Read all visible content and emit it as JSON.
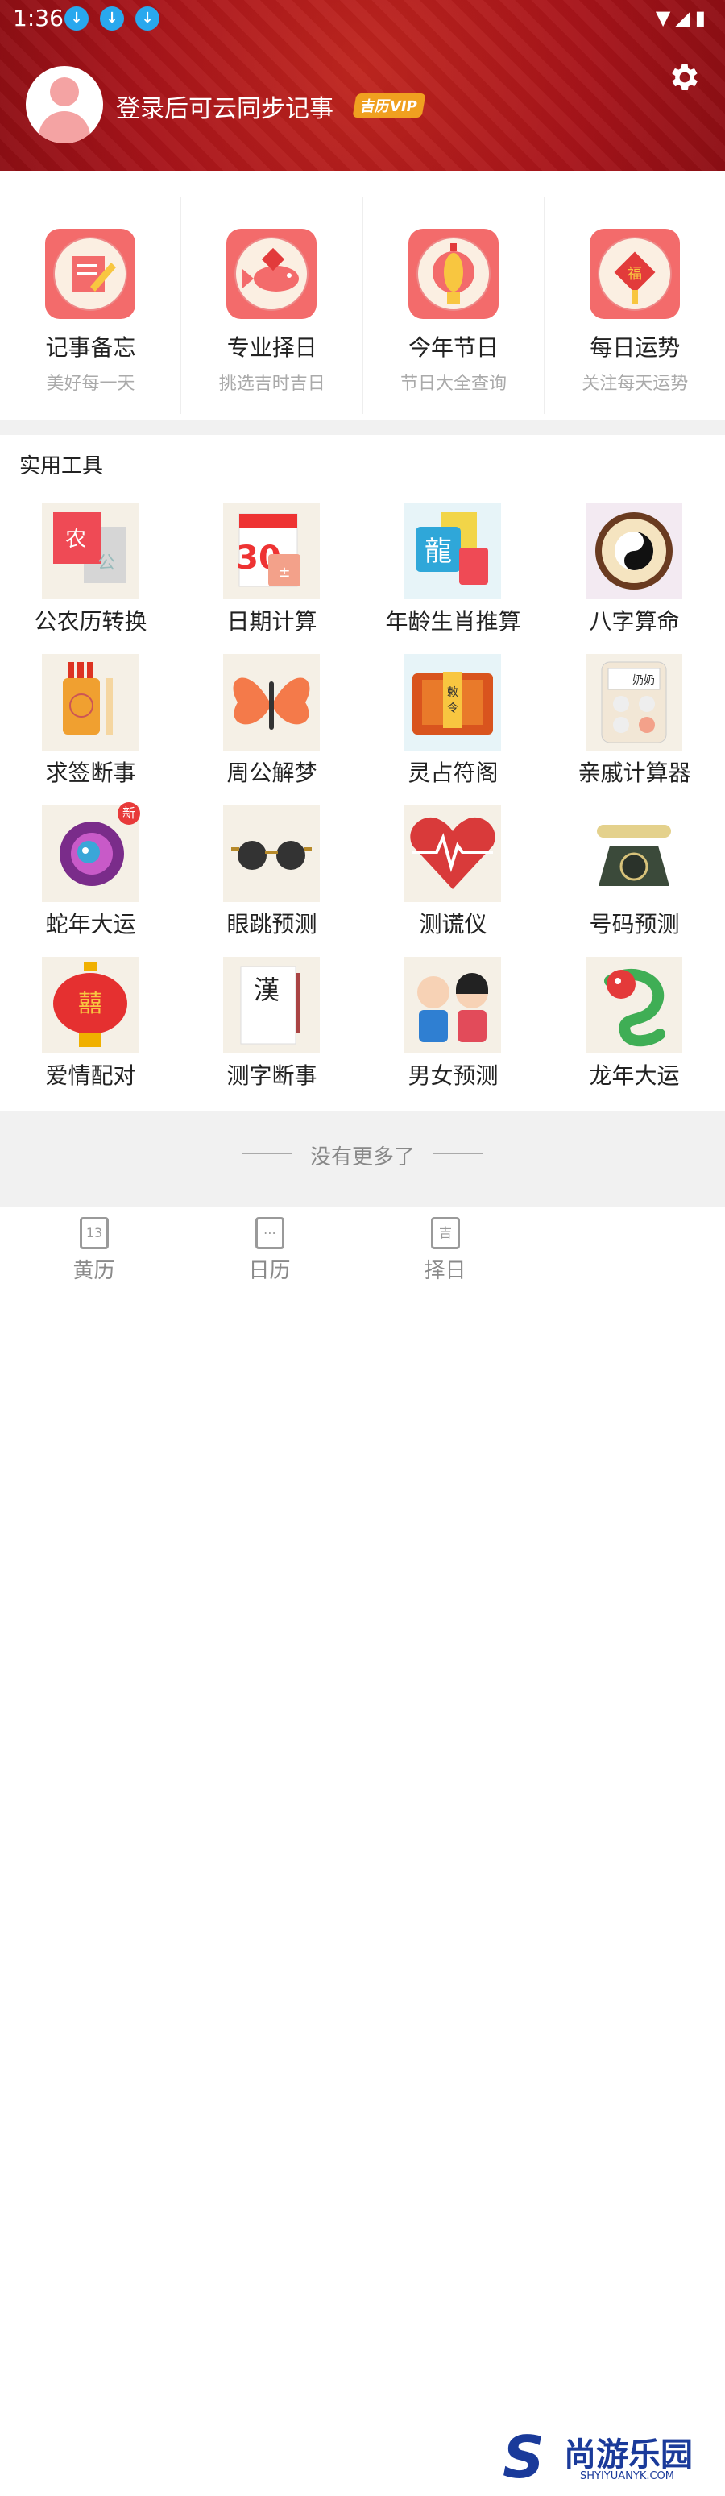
{
  "status_bar": {
    "time": "1:36"
  },
  "profile": {
    "login_prompt": "登录后可云同步记事",
    "vip_badge": "吉历VIP"
  },
  "features": [
    {
      "title": "记事备忘",
      "subtitle": "美好每一天",
      "icon": "notepad-icon"
    },
    {
      "title": "专业择日",
      "subtitle": "挑选吉时吉日",
      "icon": "fish-icon"
    },
    {
      "title": "今年节日",
      "subtitle": "节日大全查询",
      "icon": "lantern-icon"
    },
    {
      "title": "每日运势",
      "subtitle": "关注每天运势",
      "icon": "fu-knot-icon"
    }
  ],
  "tools_section": {
    "title": "实用工具"
  },
  "tools": [
    {
      "label": "公农历转换",
      "icon": "calendar-convert-icon"
    },
    {
      "label": "日期计算",
      "icon": "date-calc-icon"
    },
    {
      "label": "年龄生肖推算",
      "icon": "zodiac-age-icon"
    },
    {
      "label": "八字算命",
      "icon": "yin-yang-icon"
    },
    {
      "label": "求签断事",
      "icon": "fortune-sticks-icon"
    },
    {
      "label": "周公解梦",
      "icon": "butterfly-icon"
    },
    {
      "label": "灵占符阁",
      "icon": "talisman-icon"
    },
    {
      "label": "亲戚计算器",
      "icon": "calculator-icon"
    },
    {
      "label": "蛇年大运",
      "icon": "snake-icon",
      "badge": "新"
    },
    {
      "label": "眼跳预测",
      "icon": "sunglasses-icon"
    },
    {
      "label": "测谎仪",
      "icon": "heart-pulse-icon"
    },
    {
      "label": "号码预测",
      "icon": "telephone-icon"
    },
    {
      "label": "爱情配对",
      "icon": "double-happiness-lantern-icon"
    },
    {
      "label": "测字断事",
      "icon": "calligraphy-icon"
    },
    {
      "label": "男女预测",
      "icon": "boy-girl-icon"
    },
    {
      "label": "龙年大运",
      "icon": "dragon-icon"
    }
  ],
  "footer": {
    "no_more": "没有更多了"
  },
  "tabbar": [
    {
      "label": "黄历",
      "glyph": "13"
    },
    {
      "label": "日历",
      "glyph": "⋯"
    },
    {
      "label": "择日",
      "glyph": "吉"
    }
  ],
  "watermark": {
    "cn": "尚游乐园",
    "en": "SHYIYUANYK.COM"
  },
  "colors": {
    "header_red": "#a7141a",
    "icon_pink": "#f36b6b",
    "accent_blue": "#29a8ee"
  }
}
